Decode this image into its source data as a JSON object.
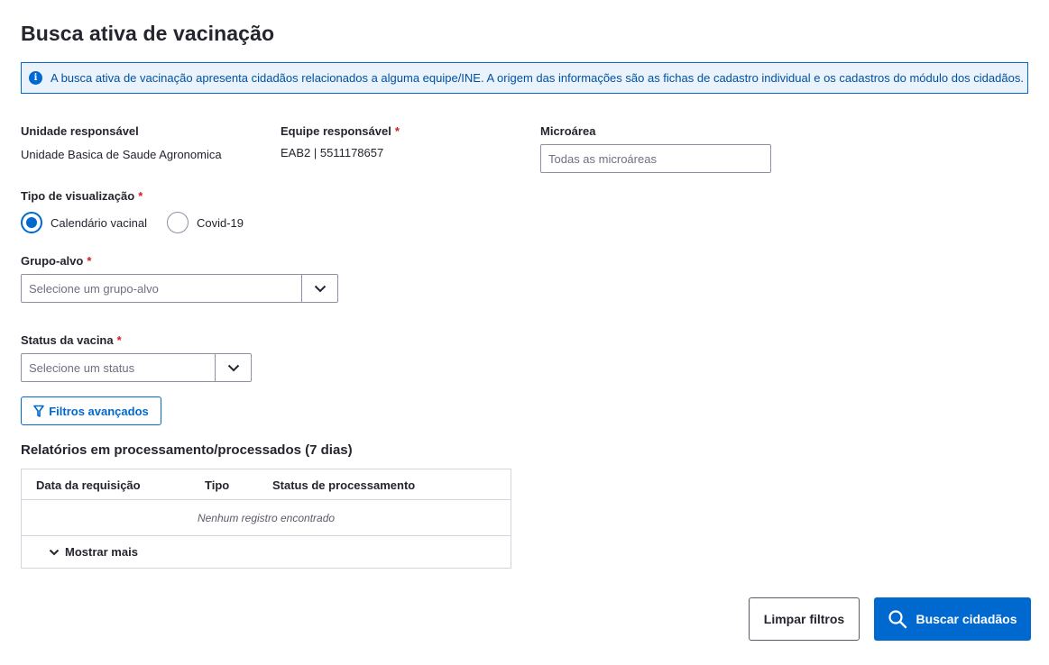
{
  "page": {
    "title": "Busca ativa de vacinação"
  },
  "info_banner": {
    "icon": "info-icon",
    "text": "A busca ativa de vacinação apresenta cidadãos relacionados a alguma equipe/INE. A origem das informações são as fichas de cadastro individual e os cadastros do módulo dos cidadãos."
  },
  "unidade": {
    "label": "Unidade responsável",
    "value": "Unidade Basica de Saude Agronomica"
  },
  "equipe": {
    "label": "Equipe responsável",
    "required": "*",
    "value": "EAB2 | 5511178657"
  },
  "microarea": {
    "label": "Microárea",
    "placeholder": "Todas as microáreas"
  },
  "tipo_visualizacao": {
    "label": "Tipo de visualização",
    "required": "*",
    "options": [
      {
        "label": "Calendário vacinal",
        "checked": true
      },
      {
        "label": "Covid-19",
        "checked": false
      }
    ]
  },
  "grupo_alvo": {
    "label": "Grupo-alvo",
    "required": "*",
    "placeholder": "Selecione um grupo-alvo"
  },
  "status_vacina": {
    "label": "Status da vacina",
    "required": "*",
    "placeholder": "Selecione um status"
  },
  "filtros_button": {
    "label": "Filtros avançados"
  },
  "relatorios": {
    "title": "Relatórios em processamento/processados (7 dias)",
    "columns": [
      "Data da requisição",
      "Tipo",
      "Status de processamento"
    ],
    "empty_text": "Nenhum registro encontrado",
    "more_label": "Mostrar mais"
  },
  "actions": {
    "clear_label": "Limpar filtros",
    "search_label": "Buscar cidadãos"
  },
  "colors": {
    "primary": "#0069d0",
    "required": "#d01e1e",
    "banner_bg": "#eaf3fb"
  }
}
